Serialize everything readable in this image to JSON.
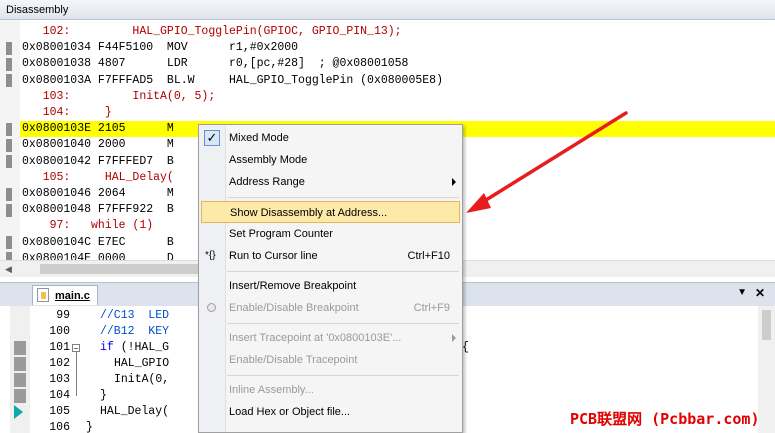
{
  "disassembly": {
    "title": "Disassembly",
    "lines": [
      {
        "text": "   102:         HAL_GPIO_TogglePin(GPIOC, GPIO_PIN_13);",
        "kind": "src"
      },
      {
        "text": "0x08001034 F44F5100  MOV      r1,#0x2000",
        "kind": "asm"
      },
      {
        "text": "0x08001038 4807      LDR      r0,[pc,#28]  ; @0x08001058",
        "kind": "asm"
      },
      {
        "text": "0x0800103A F7FFFAD5  BL.W     HAL_GPIO_TogglePin (0x080005E8)",
        "kind": "asm"
      },
      {
        "text": "   103:         InitA(0, 5);",
        "kind": "src"
      },
      {
        "text": "   104:     }",
        "kind": "src"
      },
      {
        "text": "0x0800103E 2105      M",
        "kind": "hl"
      },
      {
        "text": "0x08001040 2000      M",
        "kind": "asm"
      },
      {
        "text": "0x08001042 F7FFFED7  B",
        "kind": "asm"
      },
      {
        "text": "   105:     HAL_Delay(",
        "kind": "src"
      },
      {
        "text": "0x08001046 2064      M",
        "kind": "asm"
      },
      {
        "text": "0x08001048 F7FFF922  B",
        "kind": "asm"
      },
      {
        "text": "    97:   while (1)",
        "kind": "src"
      },
      {
        "text": "0x0800104C E7EC      B",
        "kind": "asm"
      },
      {
        "text": "0x0800104E 0000      D",
        "kind": "asm"
      }
    ]
  },
  "editor": {
    "tab_label": "main.c",
    "lines": [
      {
        "num": "99",
        "text": "//C13  LED",
        "kind": "cmt",
        "indent": 4
      },
      {
        "num": "100",
        "text": "//B12  KEY",
        "kind": "cmt",
        "indent": 4
      },
      {
        "num": "101",
        "kw": "if",
        "text": " (!HAL_G",
        "kind": "code",
        "indent": 4
      },
      {
        "num": "102",
        "text": "HAL_GPIO",
        "kind": "code",
        "indent": 6
      },
      {
        "num": "103",
        "text": "InitA(0,",
        "kind": "code",
        "indent": 6
      },
      {
        "num": "104",
        "text": "}",
        "kind": "code",
        "indent": 4
      },
      {
        "num": "105",
        "text": "HAL_Delay(",
        "kind": "code",
        "indent": 4
      },
      {
        "num": "106",
        "text": "}",
        "kind": "code",
        "indent": 2
      }
    ],
    "right_fragment": "{"
  },
  "context_menu": {
    "items": [
      {
        "label": "Mixed Mode",
        "checked": true
      },
      {
        "label": "Assembly Mode"
      },
      {
        "label": "Address Range",
        "submenu": true
      },
      {
        "separator": true
      },
      {
        "label": "Show Disassembly at Address...",
        "selected": true
      },
      {
        "label": "Set Program Counter"
      },
      {
        "label": "Run to Cursor line",
        "shortcut": "Ctrl+F10",
        "icon": "run-to-cursor-icon"
      },
      {
        "separator": true
      },
      {
        "label": "Insert/Remove Breakpoint"
      },
      {
        "label": "Enable/Disable Breakpoint",
        "shortcut": "Ctrl+F9",
        "disabled": true,
        "icon": "breakpoint-radio-icon"
      },
      {
        "separator": true
      },
      {
        "label": "Insert Tracepoint at '0x0800103E'...",
        "disabled": true,
        "submenu": true
      },
      {
        "label": "Enable/Disable Tracepoint",
        "disabled": true
      },
      {
        "separator": true
      },
      {
        "label": "Inline Assembly...",
        "disabled": true
      },
      {
        "label": "Load Hex or Object file..."
      }
    ],
    "run_icon_glyph": "*{}"
  },
  "watermark": "PCB联盟网 (Pcbbar.com)",
  "colors": {
    "highlight_line": "#ffff00",
    "menu_selected": "#fde9a8",
    "annotation_arrow": "#e81c1c",
    "source_text": "#b00000"
  }
}
